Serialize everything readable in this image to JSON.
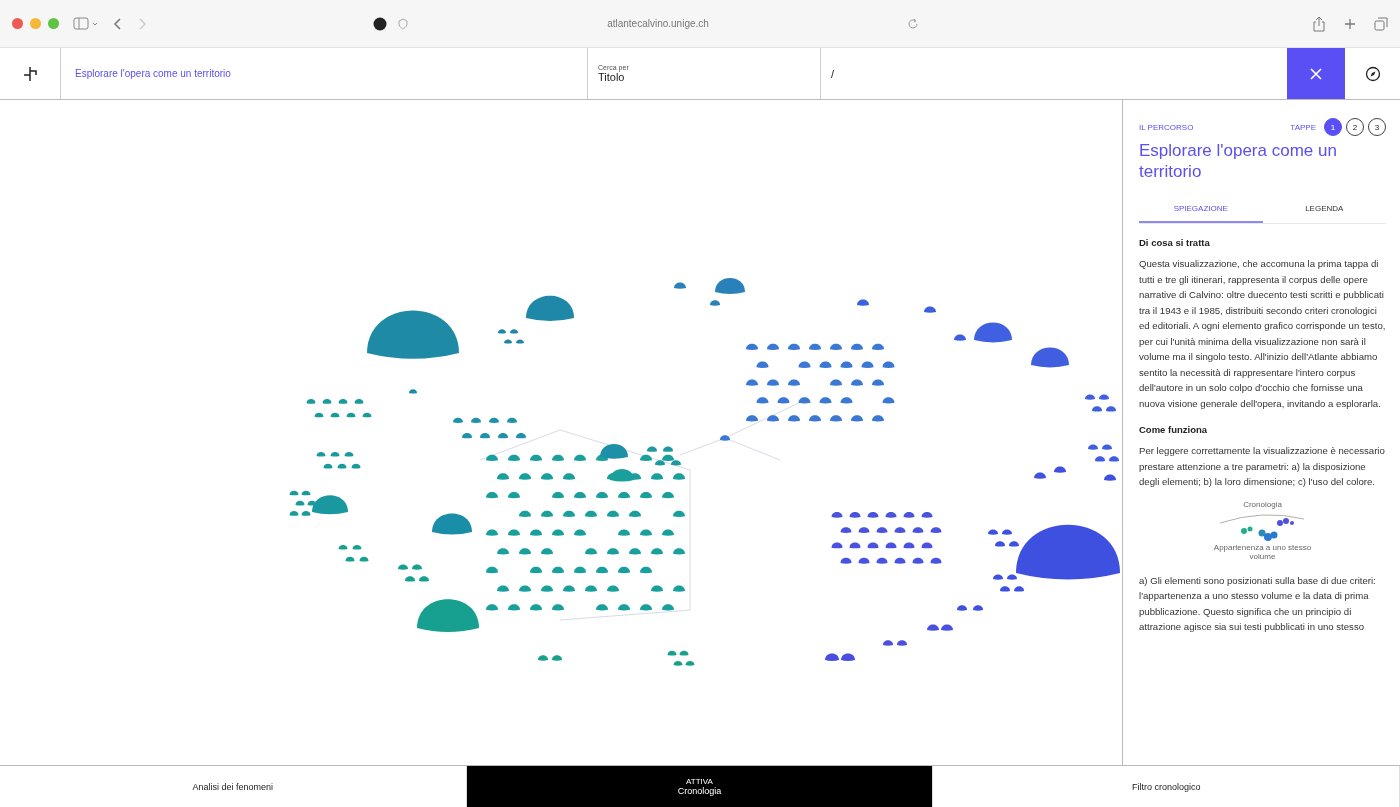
{
  "browser": {
    "url": "atlantecalvino.unige.ch"
  },
  "toolbar": {
    "path": "Esplorare l'opera come un territorio",
    "search_label": "Cerca per",
    "search_value": "Titolo",
    "query": "/"
  },
  "panel": {
    "section": "IL PERCORSO",
    "steps_label": "TAPPE",
    "steps": [
      {
        "label": "1",
        "selected": true
      },
      {
        "label": "2",
        "selected": false
      },
      {
        "label": "3",
        "selected": false
      }
    ],
    "title": "Esplorare l'opera come un territorio",
    "tabs": [
      {
        "label": "SPIEGAZIONE",
        "selected": true
      },
      {
        "label": "LEGENDA",
        "selected": false
      }
    ],
    "blocks": [
      {
        "kind": "heading",
        "text": "Di cosa si tratta"
      },
      {
        "kind": "paragraph",
        "text": "Questa visualizzazione, che accomuna la prima tappa di tutti e tre gli itinerari, rappresenta il corpus delle opere narrative di Calvino: oltre duecento testi scritti e pubblicati tra il 1943 e il 1985, distribuiti secondo criteri cronologici ed editoriali. A ogni elemento grafico corrisponde un testo, per cui l'unità minima della visualizzazione non sarà il volume ma il singolo testo. All'inizio dell'Atlante abbiamo sentito la necessità di rappresentare l'intero corpus dell'autore in un solo colpo d'occhio che fornisse una nuova visione generale dell'opera, invitando a esplorarla."
      },
      {
        "kind": "heading",
        "text": "Come funziona"
      },
      {
        "kind": "paragraph",
        "text": "Per leggere correttamente la visualizzazione è necessario prestare attenzione a tre parametri: a) la disposizione degli elementi; b) la loro dimensione; c) l'uso del colore."
      },
      {
        "kind": "figure",
        "top_label": "Cronologia",
        "bottom_label": "Appartenenza a uno stesso volume"
      },
      {
        "kind": "paragraph",
        "text": "a) Gli elementi sono posizionati sulla base di due criteri: l'appartenenza a uno stesso volume e la data di prima pubblicazione. Questo significa che un principio di attrazione agisce sia sui testi pubblicati in uno stesso"
      }
    ]
  },
  "bottom_tabs": [
    {
      "label": "Analisi dei fenomeni",
      "selected": false
    },
    {
      "caption": "ATTIVA",
      "label": "Cronologia",
      "selected": true
    },
    {
      "label": "Filtro cronologico",
      "selected": false
    }
  ]
}
